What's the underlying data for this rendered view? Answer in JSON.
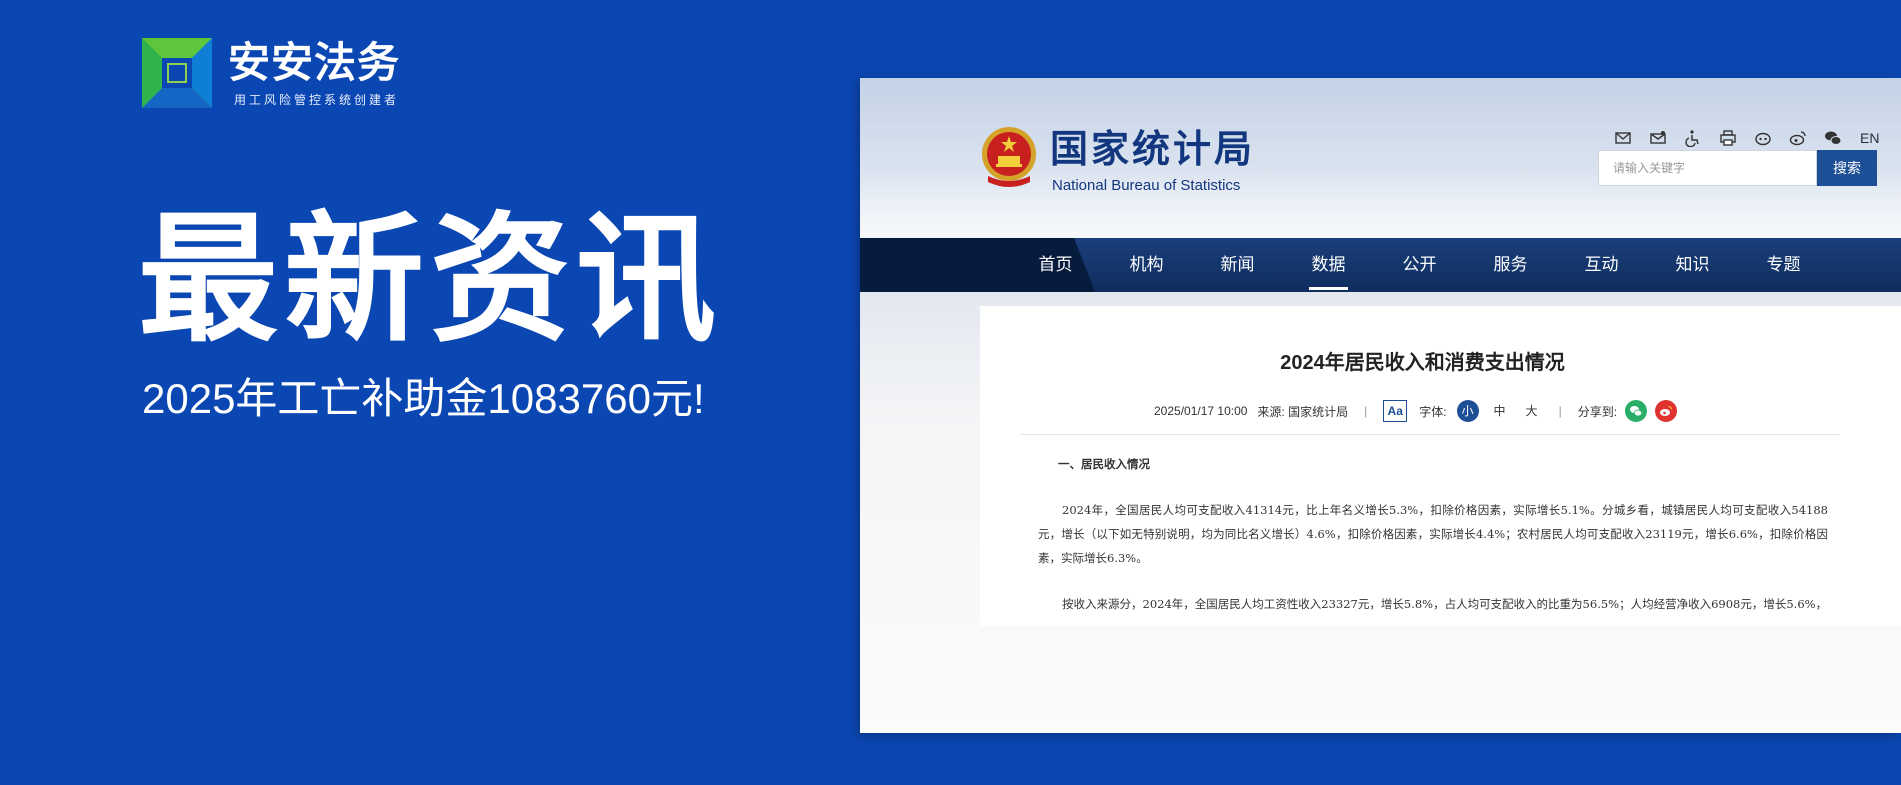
{
  "brand": {
    "name": "安安法务",
    "slogan": "用工风险管控系统创建者"
  },
  "headline": "最新资讯",
  "subheadline": "2025年工亡补助金1083760元!",
  "site": {
    "name_cn": "国家统计局",
    "name_en": "National Bureau of Statistics",
    "lang_label": "EN",
    "search_placeholder": "请输入关键字",
    "search_button": "搜索",
    "nav": [
      "首页",
      "机构",
      "新闻",
      "数据",
      "公开",
      "服务",
      "互动",
      "知识",
      "专题"
    ],
    "nav_active": "数据"
  },
  "article": {
    "title": "2024年居民收入和消费支出情况",
    "date": "2025/01/17 10:00",
    "source": "来源: 国家统计局",
    "aa_label": "Aa",
    "font_label": "字体:",
    "font_sizes": [
      "小",
      "中",
      "大"
    ],
    "share_label": "分享到:",
    "section_heading": "一、居民收入情况",
    "para1": "2024年，全国居民人均可支配收入41314元，比上年名义增长5.3%，扣除价格因素，实际增长5.1%。分城乡看，城镇居民人均可支配收入54188元，增长（以下如无特别说明，均为同比名义增长）4.6%，扣除价格因素，实际增长4.4%；农村居民人均可支配收入23119元，增长6.6%，扣除价格因素，实际增长6.3%。",
    "para2": "按收入来源分，2024年，全国居民人均工资性收入23327元，增长5.8%，占人均可支配收入的比重为56.5%；人均经营净收入6908元，增长5.6%，"
  },
  "colors": {
    "background": "#0b47b2",
    "nav": "#0f2d5e",
    "accent": "#1c4f96"
  }
}
